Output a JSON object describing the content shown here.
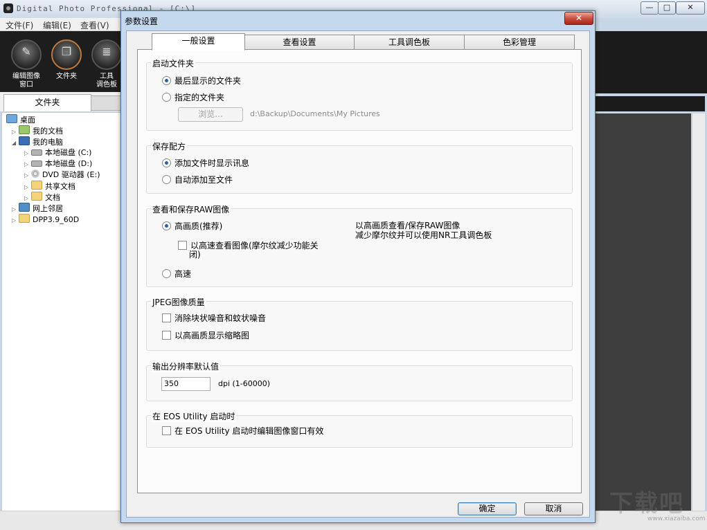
{
  "main_window": {
    "title": "Digital Photo Professional - [C:\\]",
    "controls": {
      "minimize": "—",
      "maximize": "□",
      "close": "✕"
    },
    "menu": [
      {
        "label": "文件(F)"
      },
      {
        "label": "编辑(E)"
      },
      {
        "label": "查看(V)"
      }
    ],
    "toolbar": [
      {
        "label_line1": "编辑图像",
        "label_line2": "窗口",
        "icon": "edit-window-icon",
        "glyph": "✎"
      },
      {
        "label_line1": "文件夹",
        "label_line2": "",
        "icon": "folder-icon",
        "glyph": "❐"
      },
      {
        "label_line1": "工具",
        "label_line2": "调色板",
        "icon": "tool-palette-icon",
        "glyph": "≣"
      }
    ],
    "left_tabs": {
      "active": "文件夹"
    },
    "tree": [
      {
        "label": "桌面",
        "icon": "desktop-icon",
        "twisty": ""
      },
      {
        "label": "我的文档",
        "icon": "documents-icon",
        "twisty": "▷"
      },
      {
        "label": "我的电脑",
        "icon": "computer-icon",
        "twisty": "◢"
      },
      {
        "label": "本地磁盘 (C:)",
        "icon": "disk-icon",
        "twisty": "▷"
      },
      {
        "label": "本地磁盘 (D:)",
        "icon": "disk-icon",
        "twisty": "▷"
      },
      {
        "label": "DVD 驱动器 (E:)",
        "icon": "dvd-icon",
        "twisty": "▷"
      },
      {
        "label": "共享文档",
        "icon": "folder-icon",
        "twisty": "▷"
      },
      {
        "label": "文档",
        "icon": "folder-icon",
        "twisty": "▷"
      },
      {
        "label": "网上邻居",
        "icon": "network-icon",
        "twisty": "▷"
      },
      {
        "label": "DPP3.9_60D",
        "icon": "folder-icon",
        "twisty": "▷"
      }
    ],
    "watermark": "下载吧",
    "watermark_url": "www.xiazaiba.com"
  },
  "dialog": {
    "title": "参数设置",
    "close_glyph": "✕",
    "tabs": [
      {
        "label": "一般设置"
      },
      {
        "label": "查看设置"
      },
      {
        "label": "工具调色板"
      },
      {
        "label": "色彩管理"
      }
    ],
    "startup_folder": {
      "title": "启动文件夹",
      "option_last": "最后显示的文件夹",
      "option_specified": "指定的文件夹",
      "browse_label": "浏览...",
      "path": "d:\\Backup\\Documents\\My Pictures"
    },
    "save_recipe": {
      "title": "保存配方",
      "option_add_on_display": "添加文件时显示讯息",
      "option_auto_add": "自动添加至文件"
    },
    "raw": {
      "title": "查看和保存RAW图像",
      "option_high_quality": "高画质(推荐)",
      "fast_view_line1": "以高速查看图像(摩尔纹减少功能关",
      "fast_view_line2": "闭)",
      "option_fast": "高速",
      "desc_line1": "以高画质查看/保存RAW图像",
      "desc_line2": "减少摩尔纹并可以使用NR工具调色板"
    },
    "jpeg": {
      "title": "JPEG图像质量",
      "option_remove_noise": "消除块状噪音和蚊状噪音",
      "option_hq_thumbs": "以高画质显示缩略图"
    },
    "resolution": {
      "title": "输出分辨率默认值",
      "value": "350",
      "unit": "dpi (1-60000)"
    },
    "eos": {
      "title": "在 EOS Utility 启动时",
      "option": "在 EOS Utility 启动时编辑图像窗口有效"
    },
    "ok_label": "确定",
    "cancel_label": "取消"
  }
}
